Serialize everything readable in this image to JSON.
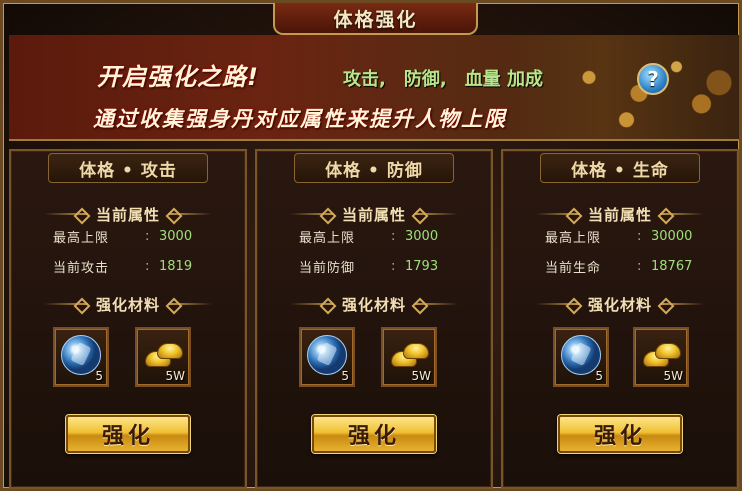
{
  "window": {
    "title": "体格强化"
  },
  "banner": {
    "heading": "开启强化之路!",
    "bonus": [
      "攻击,",
      "防御,",
      "血量 加成"
    ],
    "description": "通过收集强身丹对应属性来提升人物上限",
    "help_label": "?"
  },
  "section_labels": {
    "current": "当前属性",
    "materials": "强化材料"
  },
  "panels": [
    {
      "title": "体格 • 攻击",
      "max_label": "最高上限",
      "max_value": "3000",
      "cur_label": "当前攻击",
      "cur_value": "1819",
      "materials": [
        {
          "icon": "blue-orb-icon",
          "qty": "5"
        },
        {
          "icon": "gold-ingot-icon",
          "qty": "5W"
        }
      ],
      "button": "强化"
    },
    {
      "title": "体格 • 防御",
      "max_label": "最高上限",
      "max_value": "3000",
      "cur_label": "当前防御",
      "cur_value": "1793",
      "materials": [
        {
          "icon": "blue-orb-icon",
          "qty": "5"
        },
        {
          "icon": "gold-ingot-icon",
          "qty": "5W"
        }
      ],
      "button": "强化"
    },
    {
      "title": "体格 • 生命",
      "max_label": "最高上限",
      "max_value": "30000",
      "cur_label": "当前生命",
      "cur_value": "18767",
      "materials": [
        {
          "icon": "blue-orb-icon",
          "qty": "5"
        },
        {
          "icon": "gold-ingot-icon",
          "qty": "5W"
        }
      ],
      "button": "强化"
    }
  ],
  "colors": {
    "gold": "#c49a4c",
    "value_green": "#9ee07a",
    "bonus_green": "#b7e68a"
  }
}
